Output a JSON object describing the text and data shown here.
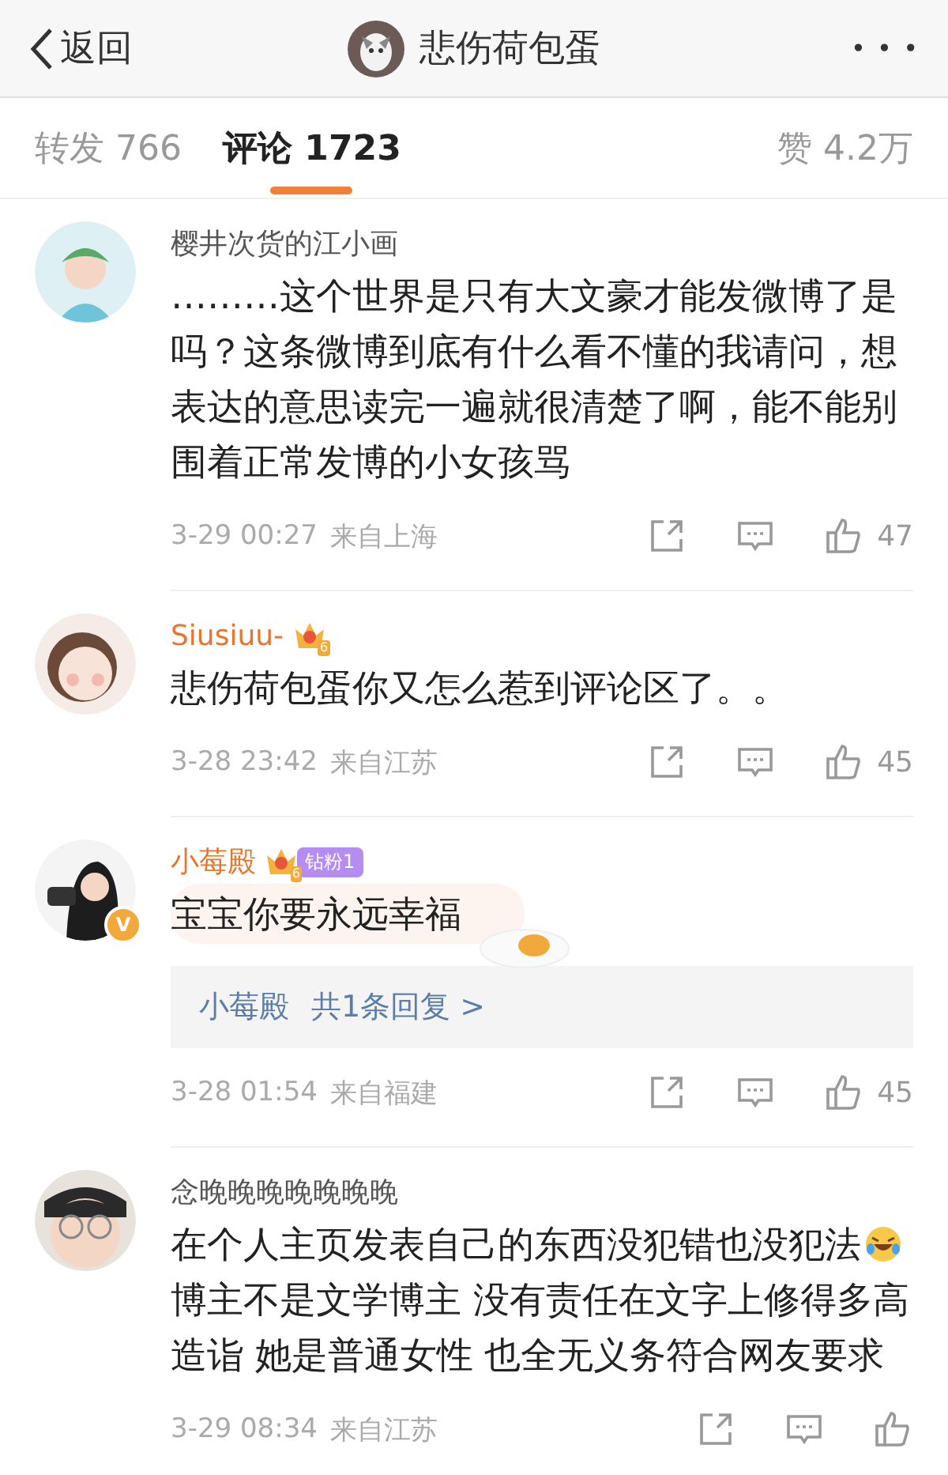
{
  "nav": {
    "back": "返回",
    "title": "悲伤荷包蛋",
    "more": "• • •"
  },
  "tabs": [
    {
      "label": "转发 766",
      "selected": false
    },
    {
      "label": "评论 1723",
      "selected": true
    }
  ],
  "likes_tab": "赞 4.2万",
  "comments": [
    {
      "name": "樱井次货的江小画",
      "kind": "plain",
      "body": [
        {
          "kind": "text",
          "text": "………这个世界是只有大文豪才能发微博了是吗？这条微博到底有什么看不懂的我请问，想表达的意思读完一遍就很清楚了啊，能不能别围着正常发博的小女孩骂"
        }
      ],
      "time": "3-29 00:27",
      "location": "来自上海",
      "likes": "47"
    },
    {
      "name": "Siusiuu-",
      "kind": "vip",
      "crown_level": "6",
      "body": [
        {
          "kind": "text",
          "text": "悲伤荷包蛋你又怎么惹到评论区了。。"
        }
      ],
      "time": "3-28 23:42",
      "location": "来自江苏",
      "likes": "45"
    },
    {
      "name": "小莓殿",
      "kind": "vip",
      "crown_level": "6",
      "fan_badge": "钻粉1",
      "verified": "V",
      "sticker": true,
      "body": [
        {
          "kind": "text",
          "text": "宝宝你要永远幸福"
        }
      ],
      "reply": {
        "author": "小莓殿",
        "summary": "共1条回复 >"
      },
      "time": "3-28 01:54",
      "location": "来自福建",
      "likes": "45"
    },
    {
      "name": "念晚晚晚晚晚晚晚",
      "kind": "plain",
      "body": [
        {
          "kind": "text",
          "text": "在个人主页发表自己的东西没犯错也没犯法"
        },
        {
          "kind": "emoji"
        },
        {
          "kind": "text",
          "text": "博主不是文学博主 没有责任在文字上修得多高造诣 她是普通女性 也全无义务符合网友要求"
        }
      ],
      "time": "3-29 08:34",
      "location": "来自江苏"
    }
  ]
}
